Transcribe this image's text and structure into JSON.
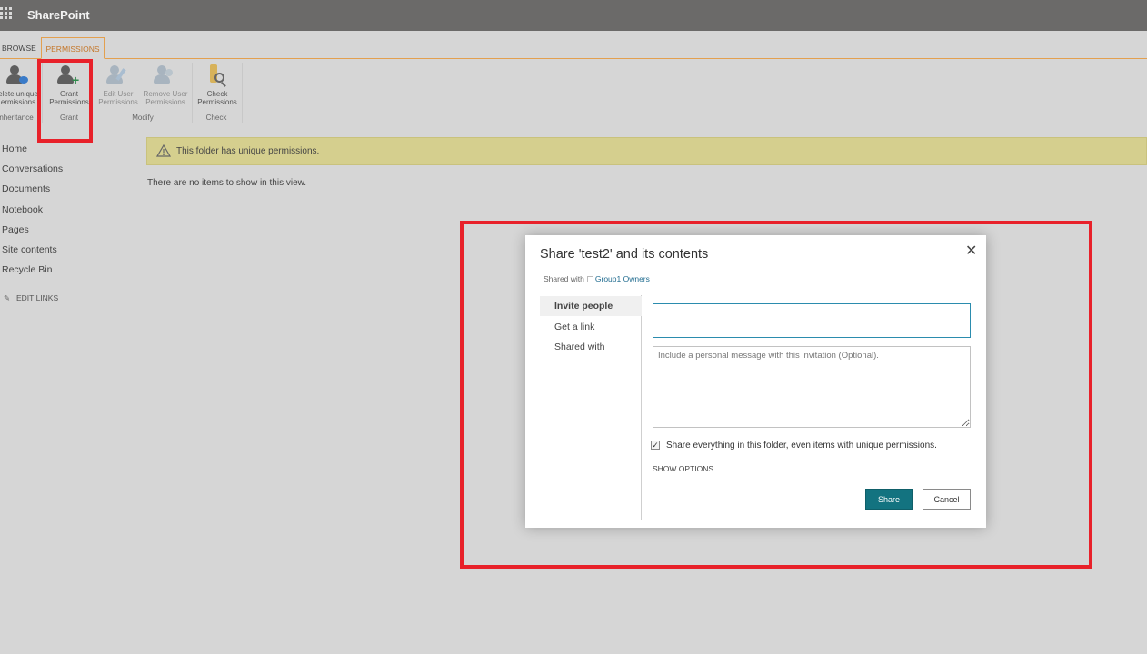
{
  "suitebar": {
    "app_title": "SharePoint",
    "icon": "app-launcher-icon"
  },
  "ribbon": {
    "tabs": [
      {
        "label": "BROWSE"
      },
      {
        "label": "PERMISSIONS"
      }
    ],
    "buttons": {
      "delete_unique": {
        "line1": "elete unique",
        "line2": "ermissions",
        "icon": "delete-permissions-icon"
      },
      "grant": {
        "line1": "Grant",
        "line2": "Permissions",
        "icon": "grant-permissions-icon"
      },
      "edit_user": {
        "line1": "Edit User",
        "line2": "Permissions",
        "icon": "edit-user-permissions-icon"
      },
      "remove_user": {
        "line1": "Remove User",
        "line2": "Permissions",
        "icon": "remove-user-permissions-icon"
      },
      "check": {
        "line1": "Check",
        "line2": "Permissions",
        "icon": "check-permissions-icon"
      }
    },
    "groups": {
      "inheritance": "nheritance",
      "grant": "Grant",
      "modify": "Modify",
      "check": "Check"
    }
  },
  "leftnav": {
    "items": [
      "Home",
      "Conversations",
      "Documents",
      "Notebook",
      "Pages",
      "Site contents",
      "Recycle Bin"
    ],
    "edit_links": "EDIT LINKS"
  },
  "status": {
    "warning": "This folder has unique permissions.",
    "empty": "There are no items to show in this view."
  },
  "dialog": {
    "title": "Share 'test2' and its contents",
    "shared_with_label": "Shared with",
    "shared_with_group": "Group1 Owners",
    "nav": [
      "Invite people",
      "Get a link",
      "Shared with"
    ],
    "people_input_value": "",
    "message_placeholder": "Include a personal message with this invitation (Optional).",
    "share_everything_label": "Share everything in this folder, even items with unique permissions.",
    "share_everything_checked": true,
    "show_options": "SHOW OPTIONS",
    "share_button": "Share",
    "cancel_button": "Cancel",
    "close_glyph": "✕"
  },
  "colors": {
    "accent": "#137380",
    "highlight": "#e8212a",
    "ribbon_active": "#c5782b",
    "warning_bar": "#d5cf8e"
  }
}
